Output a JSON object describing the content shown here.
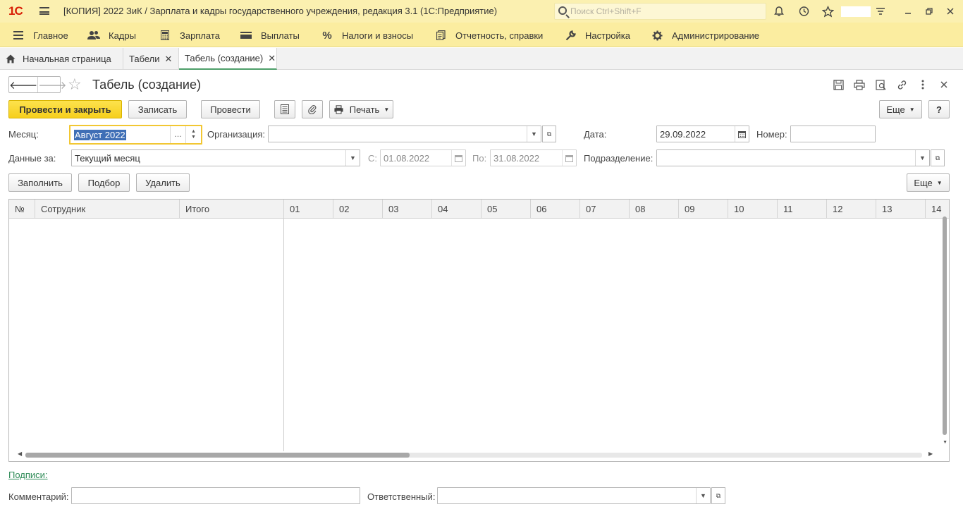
{
  "app": {
    "title": "[КОПИЯ] 2022 ЗиК / Зарплата и кадры государственного учреждения, редакция 3.1  (1С:Предприятие)",
    "search_placeholder": "Поиск Ctrl+Shift+F"
  },
  "sections": [
    {
      "label": "Главное",
      "icon": "menu-icon"
    },
    {
      "label": "Кадры",
      "icon": "people-icon"
    },
    {
      "label": "Зарплата",
      "icon": "calculator-icon"
    },
    {
      "label": "Выплаты",
      "icon": "wallet-icon"
    },
    {
      "label": "Налоги и взносы",
      "icon": "percent-icon"
    },
    {
      "label": "Отчетность, справки",
      "icon": "report-icon"
    },
    {
      "label": "Настройка",
      "icon": "wrench-icon"
    },
    {
      "label": "Администрирование",
      "icon": "gear-icon"
    }
  ],
  "tabs": [
    {
      "label": "Начальная страница"
    },
    {
      "label": "Табели"
    },
    {
      "label": "Табель (создание)"
    }
  ],
  "form": {
    "title": "Табель (создание)",
    "buttons": {
      "post_close": "Провести и закрыть",
      "save": "Записать",
      "post": "Провести",
      "print": "Печать",
      "more": "Еще",
      "help": "?"
    },
    "fields": {
      "month_label": "Месяц:",
      "month_value": "Август 2022",
      "org_label": "Организация:",
      "org_value": "",
      "date_label": "Дата:",
      "date_value": "29.09.2022",
      "number_label": "Номер:",
      "number_value": "",
      "data_for_label": "Данные за:",
      "data_for_value": "Текущий месяц",
      "from_label": "С:",
      "from_value": "01.08.2022",
      "to_label": "По:",
      "to_value": "31.08.2022",
      "dept_label": "Подразделение:",
      "dept_value": ""
    },
    "table_buttons": {
      "fill": "Заполнить",
      "pick": "Подбор",
      "delete": "Удалить",
      "more": "Еще"
    },
    "table": {
      "columns": [
        "№",
        "Сотрудник",
        "Итого",
        "01",
        "02",
        "03",
        "04",
        "05",
        "06",
        "07",
        "08",
        "09",
        "10",
        "11",
        "12",
        "13",
        "14"
      ]
    },
    "signatures_link": "Подписи:",
    "comment_label": "Комментарий:",
    "comment_value": "",
    "responsible_label": "Ответственный:",
    "responsible_value": ""
  }
}
